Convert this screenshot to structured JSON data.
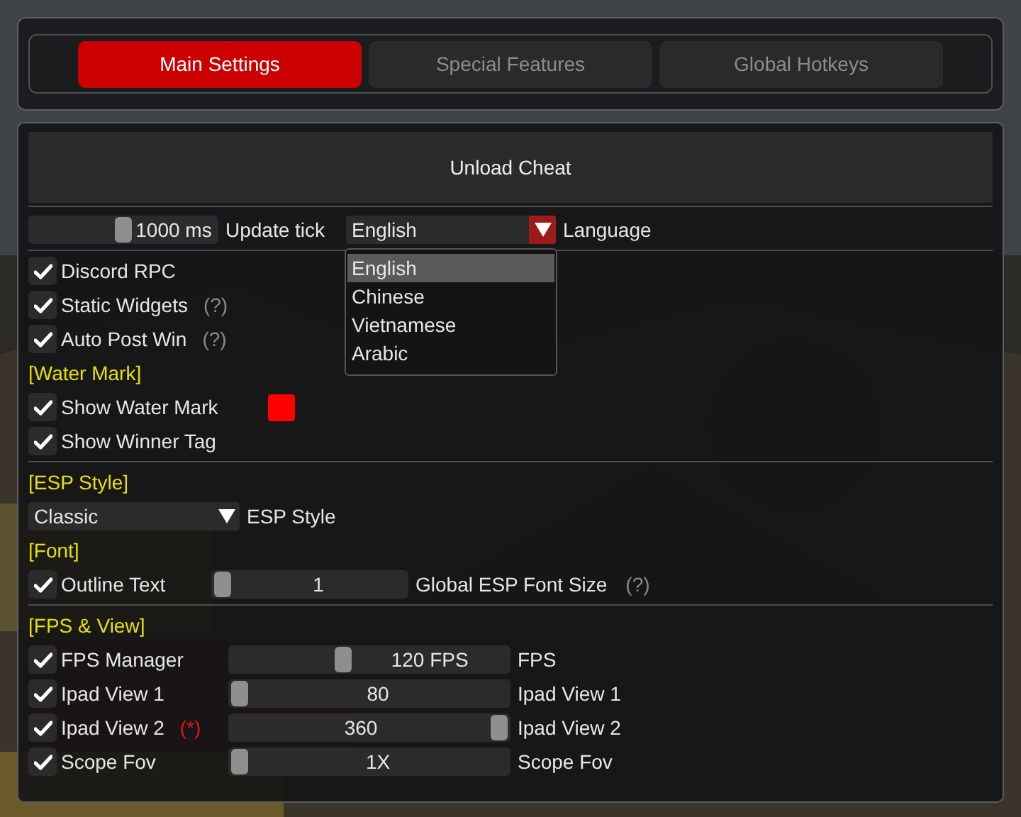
{
  "tabs": [
    {
      "label": "Main Settings",
      "selected": true
    },
    {
      "label": "Special Features",
      "selected": false
    },
    {
      "label": "Global Hotkeys",
      "selected": false
    }
  ],
  "unload_button": "Unload Cheat",
  "update_tick": {
    "value": "1000 ms",
    "level": 0.5,
    "label": "Update tick"
  },
  "language": {
    "value": "English",
    "label": "Language",
    "expanded": true,
    "options": [
      {
        "label": "English",
        "selected": true
      },
      {
        "label": "Chinese",
        "selected": false
      },
      {
        "label": "Vietnamese",
        "selected": false
      },
      {
        "label": "Arabic",
        "selected": false
      }
    ]
  },
  "groups": [
    {
      "items": [
        {
          "kind": "checkbox",
          "label": "Discord RPC",
          "checked": true
        },
        {
          "kind": "checkbox",
          "label": "Static Widgets",
          "checked": true,
          "help": "(?)"
        },
        {
          "kind": "checkbox",
          "label": "Auto Post Win",
          "checked": true,
          "help": "(?)"
        },
        {
          "kind": "heading",
          "label": "[Water Mark]"
        },
        {
          "kind": "checkbox",
          "label": "Show Water Mark",
          "checked": true,
          "color": "#ff0000"
        },
        {
          "kind": "checkbox",
          "label": "Show Winner Tag",
          "checked": true
        }
      ]
    },
    {
      "items": [
        {
          "kind": "heading",
          "label": "[ESP Style]"
        },
        {
          "kind": "combo",
          "value": "Classic",
          "caption": "ESP Style",
          "expanded": false
        },
        {
          "kind": "heading",
          "label": "[Font]"
        },
        {
          "kind": "slider",
          "label": "Outline Text",
          "checked": true,
          "value": "1",
          "level": 0,
          "slider_label": "Global ESP Font Size",
          "help": "(?)"
        }
      ]
    },
    {
      "items": [
        {
          "kind": "heading",
          "label": "[FPS & View]"
        },
        {
          "kind": "slider",
          "label": "FPS Manager",
          "checked": true,
          "value": "120 FPS",
          "level": 0.4,
          "slider_label": "FPS"
        },
        {
          "kind": "slider",
          "label": "Ipad View 1",
          "checked": true,
          "value": "80",
          "level": 0,
          "slider_label": "Ipad View 1"
        },
        {
          "kind": "slider",
          "label": "Ipad View 2",
          "checked": true,
          "note": "(*)",
          "value": "360",
          "level": 1,
          "slider_label": "Ipad View 2"
        },
        {
          "kind": "slider",
          "label": "Scope Fov",
          "checked": true,
          "value": "1X",
          "level": 0,
          "slider_label": "Scope Fov"
        }
      ]
    }
  ]
}
